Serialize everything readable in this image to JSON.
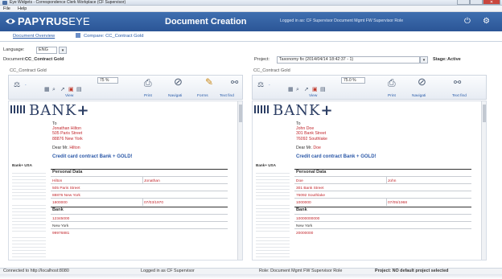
{
  "window": {
    "title": "Eye Widgets - Correspondence Clerk Workplace (CF Supervisor)",
    "close_glyph": "✕"
  },
  "menu": {
    "file": "File",
    "help": "Help"
  },
  "header": {
    "logo_bold": "PAPYRUS",
    "logo_light": "EYE",
    "title": "Document Creation",
    "status": "Logged in as: CF Supervisor   Document Mgmt FW Supervisor Role",
    "power_icon": "power-icon",
    "gear_icon": "gear-icon",
    "bg_color": "#2b5596"
  },
  "tabs": [
    {
      "label": "Document Overview"
    },
    {
      "label": "Compare: CC_Contract Gold"
    }
  ],
  "filters": {
    "language_label": "Language:",
    "language_value": "ENG",
    "document_label": "Document:",
    "document_value": "CC_Contract Gold",
    "project_label": "Project:",
    "project_value": "Taxonomy fix (2014/04/14 18:42:37 - 1)",
    "stage_label": "Stage:",
    "stage_value": "Active"
  },
  "toolbar": {
    "view": "View",
    "print": "Print",
    "navigate": "Navigati",
    "forms": "Forms",
    "textfind": "Text find",
    "zoom_left": "75 %",
    "zoom_right": "75.0 %",
    "dash": "-"
  },
  "panes": [
    {
      "title": "CC_Contract Gold",
      "to": "To",
      "addr_name": "Jonathan Hilton",
      "addr_street": "505 Paris Street",
      "addr_city": "88876 New York",
      "dear_prefix": "Dear Mr.",
      "dear_name": "Hilton",
      "credit": "Credit card contract Bank + GOLD!",
      "personal_name": "Hilton",
      "personal_first": "Jonathan",
      "personal_street": "505 Paris Street",
      "personal_city": "88876 New York",
      "personal_a": "1800000",
      "personal_b": "07/03/1970",
      "bank_a": "12345000",
      "bank_b": "New York",
      "bank_c": "99976881"
    },
    {
      "title": "CC_Contract Gold",
      "to": "To",
      "addr_name": "John Doe",
      "addr_street": "301 Bank Street",
      "addr_city": "76092 Southlake",
      "dear_prefix": "Dear Mr.",
      "dear_name": "Doe",
      "credit": "Credit card contract Bank + GOLD!",
      "personal_name": "Doe",
      "personal_first": "John",
      "personal_street": "301 Bank Street",
      "personal_city": "76092 Southlake",
      "personal_a": "1000000",
      "personal_b": "07/05/1968",
      "bank_a": "10000000000",
      "bank_b": "New York",
      "bank_c": "20000000"
    }
  ],
  "doc_labels": {
    "bank_word": "BANK",
    "bank_plus": "+",
    "bank_usa": "Bank+ USA",
    "personal_data": "Personal Data",
    "bank": "Bank"
  },
  "statusbar": {
    "connected": "Connected to http://localhost:8080",
    "logged": "Logged in as CF Supervisor",
    "role": "Role: Document Mgmt FW Supervisor Role",
    "project": "Project: NO default project selected"
  }
}
